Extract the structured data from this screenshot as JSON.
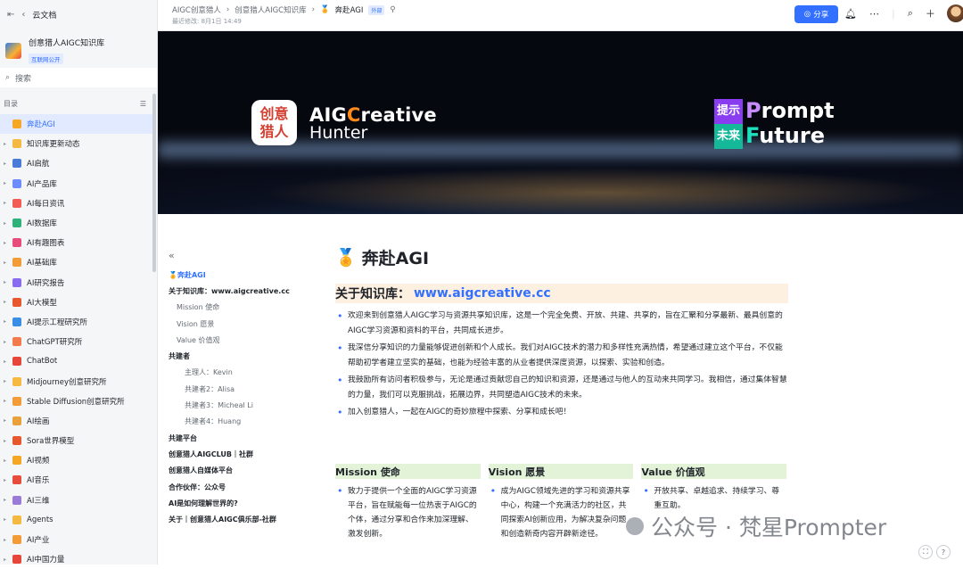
{
  "sidebar": {
    "back_label": "云文档",
    "kb_name": "创意猎人AIGC知识库",
    "kb_badge": "互联网公开",
    "search_placeholder": "搜索",
    "toc_label": "目录",
    "items": [
      {
        "label": "奔赴AGI",
        "color": "#f5a623",
        "active": true
      },
      {
        "label": "知识库更新动态",
        "color": "#f5b942"
      },
      {
        "label": "AI启航",
        "color": "#4a7bd8"
      },
      {
        "label": "AI产品库",
        "color": "#6c8cff"
      },
      {
        "label": "AI每日资讯",
        "color": "#f25c54"
      },
      {
        "label": "AI数据库",
        "color": "#2fb27a"
      },
      {
        "label": "AI有趣图表",
        "color": "#e84c7a"
      },
      {
        "label": "AI基础库",
        "color": "#f29b37"
      },
      {
        "label": "AI研究报告",
        "color": "#8a6cf0"
      },
      {
        "label": "AI大模型",
        "color": "#e8582f"
      },
      {
        "label": "AI提示工程研究所",
        "color": "#3a8ee6"
      },
      {
        "label": "ChatGPT研究所",
        "color": "#f27a4b"
      },
      {
        "label": "ChatBot",
        "color": "#e9463b"
      },
      {
        "label": "Midjourney创意研究所",
        "color": "#f5b942"
      },
      {
        "label": "Stable Diffusion创意研究所",
        "color": "#f29b37"
      },
      {
        "label": "AI绘画",
        "color": "#e9a23b"
      },
      {
        "label": "Sora世界模型",
        "color": "#e8582f"
      },
      {
        "label": "AI视频",
        "color": "#f5a623"
      },
      {
        "label": "AI音乐",
        "color": "#e84c3d"
      },
      {
        "label": "AI三维",
        "color": "#9b7bd8"
      },
      {
        "label": "Agents",
        "color": "#f5b942"
      },
      {
        "label": "AI产业",
        "color": "#f29b37"
      },
      {
        "label": "AI中国力量",
        "color": "#e9463b"
      }
    ]
  },
  "header": {
    "crumbs": [
      "AIGC创意猎人",
      "创意猎人AIGC知识库",
      "奔赴AGI"
    ],
    "crumb_tag": "外部",
    "meta": "最近修改: 8月1日 14:49",
    "share_label": "分享"
  },
  "banner": {
    "logo_text": "创意\n猎人",
    "title_pre": "AIG",
    "title_c": "C",
    "title_post": "reative",
    "subtitle": "Hunter",
    "tag1": "提示",
    "word1_first": "P",
    "word1_rest": "rompt",
    "tag2": "未来",
    "word2_first": "F",
    "word2_rest": "uture"
  },
  "toc": [
    {
      "label": "奔赴AGI",
      "level": "act"
    },
    {
      "label": "关于知识库：www.aigcreative.cc",
      "level": "b"
    },
    {
      "label": "Mission 使命",
      "level": "l2"
    },
    {
      "label": "Vision 愿景",
      "level": "l2"
    },
    {
      "label": "Value 价值观",
      "level": "l2"
    },
    {
      "label": "共建者",
      "level": "b"
    },
    {
      "label": "主理人：Kevin",
      "level": "l3"
    },
    {
      "label": "共建者2：Alisa",
      "level": "l3"
    },
    {
      "label": "共建者3：Micheal Li",
      "level": "l3"
    },
    {
      "label": "共建者4：Huang",
      "level": "l3"
    },
    {
      "label": "共建平台",
      "level": "b"
    },
    {
      "label": "创意猎人AIGCLUB｜社群",
      "level": "b"
    },
    {
      "label": "创意猎人自媒体平台",
      "level": "b"
    },
    {
      "label": "合作伙伴：公众号",
      "level": "b"
    },
    {
      "label": "AI是如何理解世界的?",
      "level": "b"
    },
    {
      "label": "关于｜创意猎人AIGC俱乐部-社群",
      "level": "b"
    }
  ],
  "doc": {
    "title": "奔赴AGI",
    "h2_prefix": "关于知识库：",
    "h2_link": "www.aigcreative.cc",
    "bullets": [
      "欢迎来到创意猎人AIGC学习与资源共享知识库，这是一个完全免费、开放、共建、共享的，旨在汇聚和分享最新、最具创意的AIGC学习资源和资料的平台，共同成长进步。",
      "我深信分享知识的力量能够促进创新和个人成长。我们对AIGC技术的潜力和多样性充满热情，希望通过建立这个平台，不仅能帮助初学者建立坚实的基础，也能为经验丰富的从业者提供深度资源，以探索、实验和创造。",
      "我鼓励所有访问者积极参与，无论是通过贡献您自己的知识和资源，还是通过与他人的互动来共同学习。我相信，通过集体智慧的力量，我们可以克服挑战，拓展边界，共同塑造AIGC技术的未来。",
      "加入创意猎人，一起在AIGC的奇妙旅程中探索、分享和成长吧！"
    ],
    "columns": [
      {
        "title": "Mission 使命",
        "text": "致力于提供一个全面的AIGC学习资源平台，旨在赋能每一位热衷于AIGC的个体，通过分享和合作来加深理解、激发创新。"
      },
      {
        "title": "Vision 愿景",
        "text": "成为AIGC领域先进的学习和资源共享中心，构建一个充满活力的社区，共同探索AI创新应用，为解决复杂问题和创造新奇内容开辟新途径。"
      },
      {
        "title": "Value 价值观",
        "text": "开放共享、卓越追求、持续学习、尊重互助。"
      }
    ]
  },
  "watermark": "公众号 · 梵星Prompter"
}
